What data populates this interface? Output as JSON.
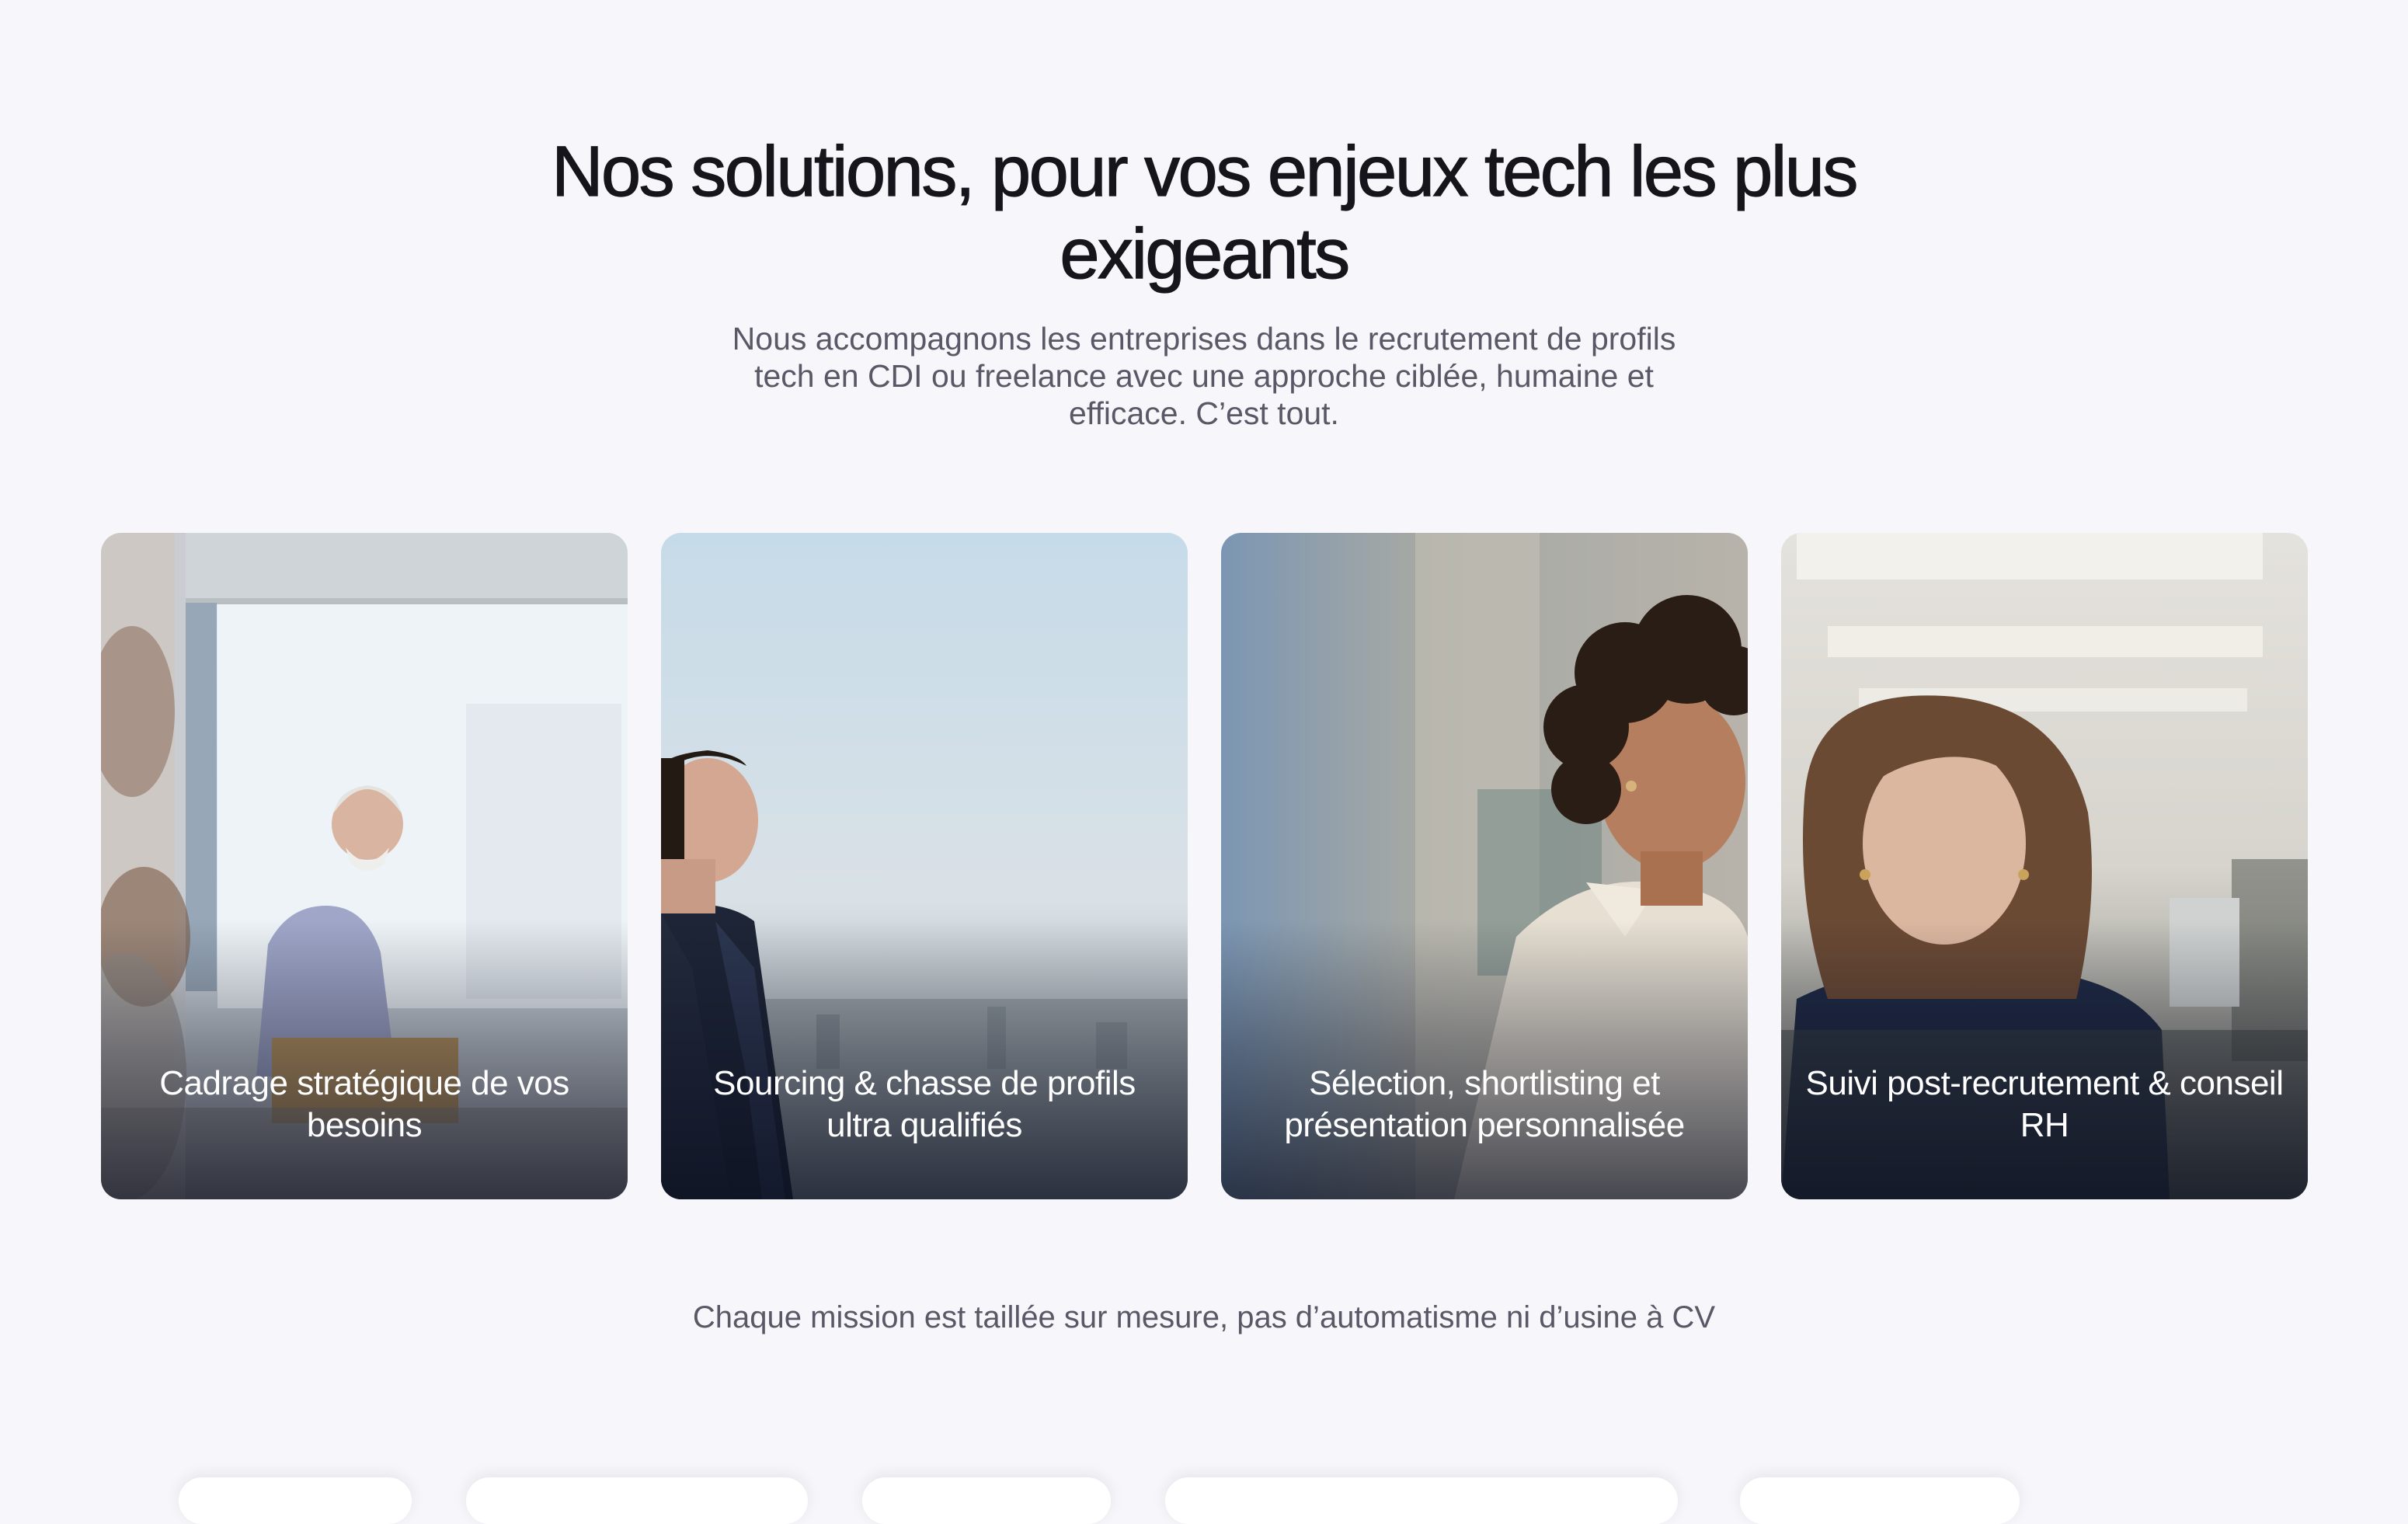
{
  "section": {
    "title": "Nos solutions, pour vos enjeux tech les plus exigeants",
    "subtitle": "Nous accompagnons les entreprises dans le recrutement de profils tech en CDI ou freelance avec une approche ciblée, humaine et efficace. C’est tout.",
    "footnote": "Chaque mission est taillée sur mesure, pas d’automatisme ni d’usine à CV"
  },
  "cards": [
    {
      "label": "Cadrage stratégique de vos besoins",
      "image": "man-presenting-in-office-photo"
    },
    {
      "label": "Sourcing & chasse de profils ultra qualifiés",
      "image": "man-looking-at-city-view-photo"
    },
    {
      "label": "Sélection, shortlisting et présentation personnalisée",
      "image": "woman-in-white-shirt-photo"
    },
    {
      "label": "Suivi post-recrutement & conseil RH",
      "image": "woman-at-computer-photo"
    }
  ],
  "colors": {
    "background": "#f7f6fa",
    "heading": "#16151c",
    "body_text": "#5a5866",
    "card_label": "#ffffff"
  }
}
